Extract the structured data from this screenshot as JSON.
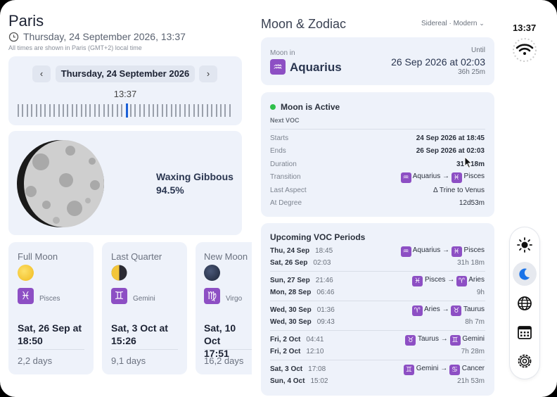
{
  "header": {
    "city": "Paris",
    "datetime": "Thursday, 24 September 2026, 13:37",
    "timezone_note": "All times are shown in Paris (GMT+2) local time"
  },
  "date_nav": {
    "prev_icon": "chevron-left",
    "date_label": "Thursday, 24 September 2026",
    "next_icon": "chevron-right",
    "time": "13:37"
  },
  "moon_phase": {
    "name": "Waxing Gibbous",
    "illumination": "94.5%"
  },
  "phases": [
    {
      "label": "Full Moon",
      "sign_symbol": "♓",
      "sign": "Pisces",
      "date": "Sat, 26 Sep at",
      "time": "18:50",
      "duration": "2,2 days"
    },
    {
      "label": "Last Quarter",
      "sign_symbol": "♊",
      "sign": "Gemini",
      "date": "Sat, 3 Oct at",
      "time": "15:26",
      "duration": "9,1 days"
    },
    {
      "label": "New Moon",
      "sign_symbol": "♍",
      "sign": "Virgo",
      "date": "Sat, 10 Oct",
      "time": "17:51",
      "duration": "16,2 days"
    }
  ],
  "zodiac": {
    "section_title": "Moon & Zodiac",
    "mode": "Sidereal · Modern",
    "moon_in_label": "Moon in",
    "sign_symbol": "♒",
    "sign": "Aquarius",
    "until_label": "Until",
    "until_value": "26 Sep 2026 at 02:03",
    "remaining": "36h 25m"
  },
  "voc": {
    "status": "Moon is Active",
    "status_color": "#2fbf4a",
    "next_label": "Next VOC",
    "rows": [
      {
        "label": "Starts",
        "value": "24 Sep 2026 at 18:45"
      },
      {
        "label": "Ends",
        "value": "26 Sep 2026 at 02:03"
      },
      {
        "label": "Duration",
        "value": "31h 18m"
      },
      {
        "label": "Transition",
        "from_symbol": "♒",
        "from": "Aquarius",
        "arrow": "→",
        "to_symbol": "♓",
        "to": "Pisces"
      },
      {
        "label": "Last Aspect",
        "value": "Δ Trine to Venus"
      },
      {
        "label": "At Degree",
        "value": "12d53m"
      }
    ]
  },
  "upcoming": {
    "title": "Upcoming VOC Periods",
    "periods": [
      {
        "start_day": "Thu, 24 Sep",
        "start_time": "18:45",
        "end_day": "Sat, 26 Sep",
        "end_time": "02:03",
        "from_symbol": "♒",
        "from": "Aquarius",
        "to_symbol": "♓",
        "to": "Pisces",
        "duration": "31h 18m"
      },
      {
        "start_day": "Sun, 27 Sep",
        "start_time": "21:46",
        "end_day": "Mon, 28 Sep",
        "end_time": "06:46",
        "from_symbol": "♓",
        "from": "Pisces",
        "to_symbol": "♈",
        "to": "Aries",
        "duration": "9h"
      },
      {
        "start_day": "Wed, 30 Sep",
        "start_time": "01:36",
        "end_day": "Wed, 30 Sep",
        "end_time": "09:43",
        "from_symbol": "♈",
        "from": "Aries",
        "to_symbol": "♉",
        "to": "Taurus",
        "duration": "8h 7m"
      },
      {
        "start_day": "Fri, 2 Oct",
        "start_time": "04:41",
        "end_day": "Fri, 2 Oct",
        "end_time": "12:10",
        "from_symbol": "♉",
        "from": "Taurus",
        "to_symbol": "♊",
        "to": "Gemini",
        "duration": "7h 28m"
      },
      {
        "start_day": "Sat, 3 Oct",
        "start_time": "17:08",
        "end_day": "Sun, 4 Oct",
        "end_time": "15:02",
        "from_symbol": "♊",
        "from": "Gemini",
        "to_symbol": "♋",
        "to": "Cancer",
        "duration": "21h 53m"
      }
    ]
  },
  "status_bar": {
    "time": "13:37"
  },
  "sidebar": {
    "items": [
      "sun-icon",
      "moon-icon",
      "globe-icon",
      "calendar-icon",
      "settings-icon"
    ],
    "active": "moon-icon"
  }
}
